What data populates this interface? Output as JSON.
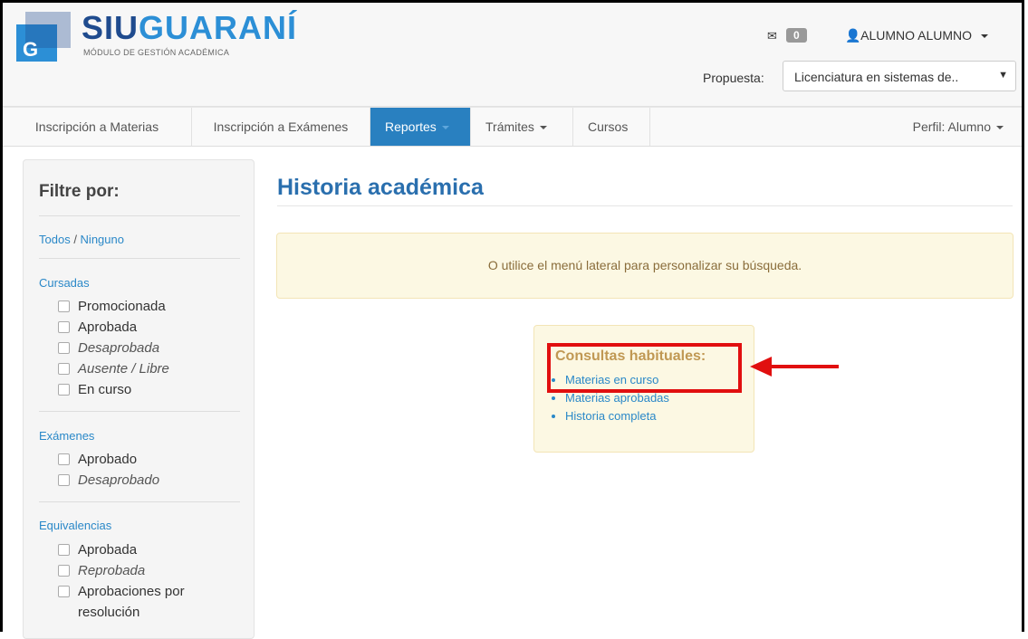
{
  "header": {
    "brand_siu": "SIU",
    "brand_guarani": "GUARANÍ",
    "subtitle": "MÓDULO DE GESTIÓN ACADÉMICA",
    "logo_letter": "G",
    "messages_count": "0",
    "user_name": "ALUMNO ALUMNO",
    "propuesta_label": "Propuesta:",
    "propuesta_value": "Licenciatura en sistemas de.."
  },
  "nav": {
    "items": [
      {
        "label": "Inscripción a Materias"
      },
      {
        "label": "Inscripción a Exámenes"
      },
      {
        "label": "Reportes"
      },
      {
        "label": "Trámites"
      },
      {
        "label": "Cursos"
      }
    ],
    "perfil": "Perfil: Alumno"
  },
  "sidebar": {
    "title": "Filtre por:",
    "todos": "Todos",
    "slash": " / ",
    "ninguno": "Ninguno",
    "cursadas": {
      "title": "Cursadas",
      "items": [
        "Promocionada",
        "Aprobada",
        "Desaprobada",
        "Ausente / Libre",
        "En curso"
      ]
    },
    "examenes": {
      "title": "Exámenes",
      "items": [
        "Aprobado",
        "Desaprobado"
      ]
    },
    "equivalencias": {
      "title": "Equivalencias",
      "items": [
        "Aprobada",
        "Reprobada",
        "Aprobaciones por",
        "resolución"
      ]
    }
  },
  "main": {
    "title": "Historia académica",
    "alert": "O utilice el menú lateral para personalizar su búsqueda.",
    "consultas_title": "Consultas habituales:",
    "consultas": [
      "Materias en curso",
      "Materias aprobadas",
      "Historia completa"
    ]
  },
  "colors": {
    "accent": "#2980c0",
    "brand_dark": "#1f4b8e",
    "brand_light": "#2c8fd6",
    "highlight": "#e10f0f"
  }
}
